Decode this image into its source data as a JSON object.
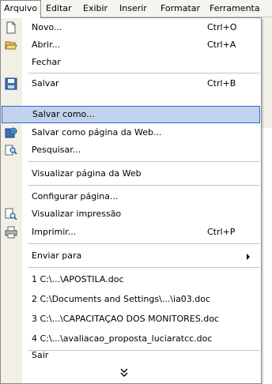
{
  "menubar": {
    "items": [
      {
        "label": "Arquivo",
        "accel": "A"
      },
      {
        "label": "Editar",
        "accel": "E"
      },
      {
        "label": "Exibir",
        "accel": "x"
      },
      {
        "label": "Inserir",
        "accel": "I"
      },
      {
        "label": "Formatar",
        "accel": "F"
      },
      {
        "label": "Ferramenta"
      }
    ]
  },
  "menu": {
    "items": [
      {
        "label": "Novo...",
        "shortcut": "Ctrl+O",
        "icon": "new-document-icon"
      },
      {
        "label": "Abrir...",
        "shortcut": "Ctrl+A",
        "icon": "open-folder-icon"
      },
      {
        "label": "Fechar",
        "shortcut": ""
      },
      {
        "label": "Salvar",
        "shortcut": "Ctrl+B",
        "icon": "save-disk-icon"
      },
      {
        "label": "Salvar como...",
        "shortcut": "",
        "highlighted": true
      },
      {
        "label": "Salvar como página da Web...",
        "shortcut": "",
        "icon": "save-web-icon"
      },
      {
        "label": "Pesquisar...",
        "shortcut": "",
        "icon": "search-file-icon"
      },
      {
        "label": "Visualizar página da Web",
        "shortcut": ""
      },
      {
        "label": "Configurar página...",
        "shortcut": ""
      },
      {
        "label": "Visualizar impressão",
        "shortcut": "",
        "icon": "print-preview-icon"
      },
      {
        "label": "Imprimir...",
        "shortcut": "Ctrl+P",
        "icon": "printer-icon"
      },
      {
        "label": "Enviar para",
        "shortcut": "",
        "submenu": true
      },
      {
        "label": "1 C:\\...\\APOSTILA.doc"
      },
      {
        "label": "2 C:\\Documents and Settings\\...\\ia03.doc"
      },
      {
        "label": "3 C:\\...\\CAPACITAÇAO DOS MONITORES.doc"
      },
      {
        "label": "4 C:\\...\\avaliacao_proposta_luciaratcc.doc"
      },
      {
        "label": "Sair"
      }
    ],
    "more_icon": "expand-chevron-icon"
  },
  "colors": {
    "menubar_bg": "#f5f4ee",
    "icon_strip": "#f1efe6",
    "highlight_bg": "#c1d2ee",
    "highlight_border": "#316ac5"
  }
}
